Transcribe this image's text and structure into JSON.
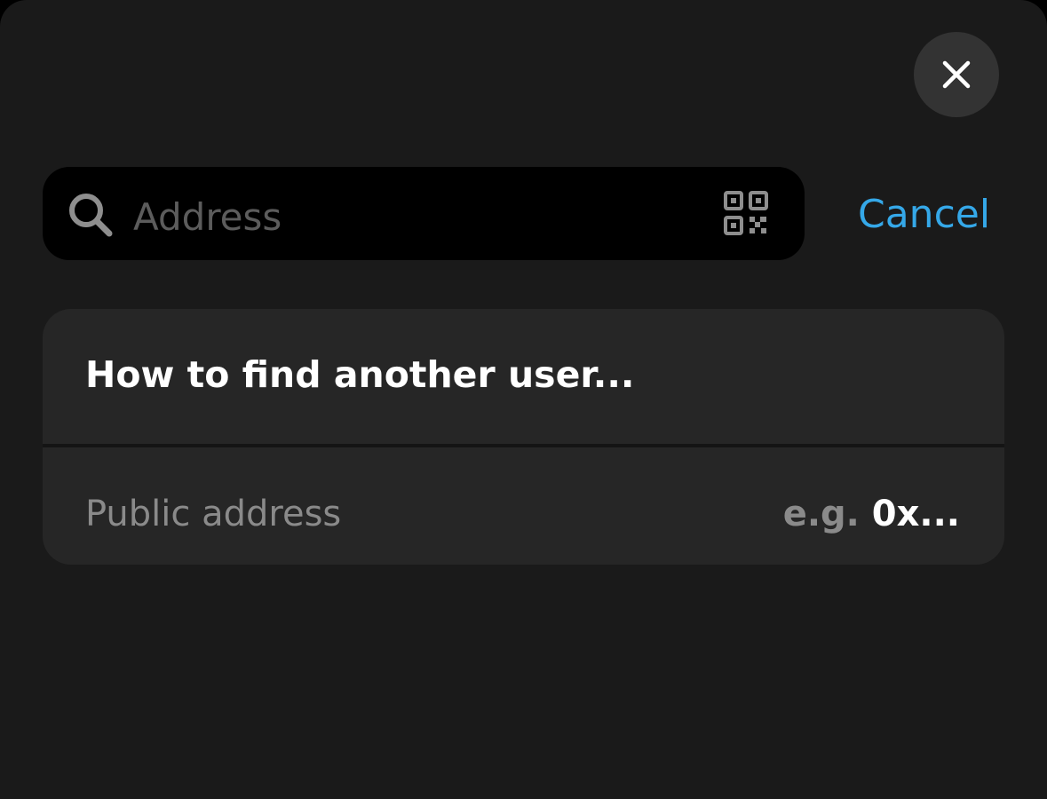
{
  "close_button": {
    "icon": "close-icon"
  },
  "search": {
    "placeholder": "Address",
    "value": "",
    "icon": "search-icon",
    "scan_icon": "qr-code-icon"
  },
  "cancel_label": "Cancel",
  "info_card": {
    "title": "How to find another user...",
    "row_label": "Public address",
    "example_prefix": "e.g.",
    "example_value": "0x..."
  },
  "colors": {
    "background": "#1a1a1a",
    "card": "#262626",
    "search_field": "#000000",
    "accent": "#35a8e8",
    "close_button": "#333333",
    "muted_text": "#8a8a8a",
    "primary_text": "#ffffff"
  }
}
